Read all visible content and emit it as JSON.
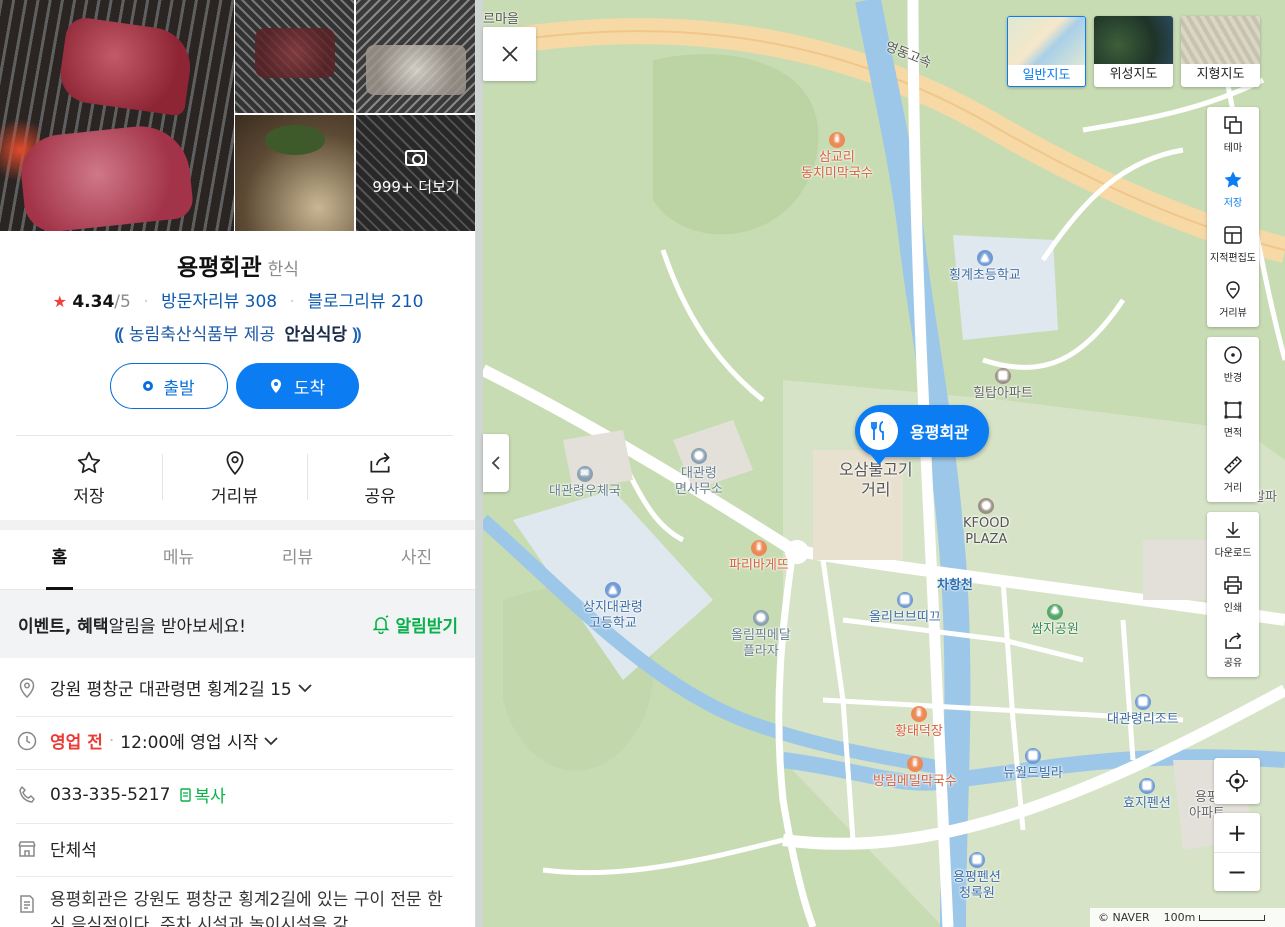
{
  "place": {
    "name": "용평회관",
    "category": "한식",
    "rating_star": "★",
    "rating": "4.34",
    "rating_max": "/5",
    "visitor_reviews": "방문자리뷰 308",
    "blog_reviews": "블로그리뷰 210",
    "cert_text": "농림축산식품부 제공",
    "cert_brand": "안심식당",
    "more_photos": "999+ 더보기"
  },
  "directions": {
    "start_label": "출발",
    "end_label": "도착"
  },
  "actions": [
    {
      "label": "저장",
      "icon": "star-outline-icon"
    },
    {
      "label": "거리뷰",
      "icon": "location-pin-icon"
    },
    {
      "label": "공유",
      "icon": "share-icon"
    }
  ],
  "tabs": [
    "홈",
    "메뉴",
    "리뷰",
    "사진"
  ],
  "notice": {
    "bold": "이벤트, 혜택",
    "rest": " 알림을 받아보세요!",
    "button": "알림받기"
  },
  "info": {
    "address": "강원 평창군 대관령면 횡계2길 15",
    "status": "영업 전",
    "hours": "12:00에 영업 시작",
    "phone": "033-335-5217",
    "copy": "복사",
    "facility": "단체석",
    "description": "용평회관은 강원도 평창군 횡계2길에 있는 구이 전문 한식 음식점이다. 주차 시설과 놀이시설을 갖"
  },
  "map": {
    "map_types": [
      "일반지도",
      "위성지도",
      "지형지도"
    ],
    "tools_a": [
      "테마",
      "저장",
      "지적편집도",
      "거리뷰"
    ],
    "tools_b": [
      "반경",
      "면적",
      "거리"
    ],
    "tools_c": [
      "다운로드",
      "인쇄",
      "공유"
    ],
    "zoom_in": "+",
    "zoom_out": "−",
    "copyright": "© NAVER",
    "scale": "100m",
    "marker_label": "용평회관",
    "pois": {
      "p1": "삼교리\n동치미막국수",
      "p2": "횡계초등학교",
      "p3": "힐탑아파트",
      "p4": "대관령\n면사무소",
      "p5": "대관령우체국",
      "p6": "오삼불고기\n거리",
      "p7": "KFOOD\nPLAZA",
      "p8": "파리바게뜨",
      "p9": "상지대관령\n고등학교",
      "p10": "올림픽메달\n플라자",
      "p11": "올리브브띠끄",
      "p12": "쌈지공원",
      "p13": "황태덕장",
      "p14": "방림메밀막국수",
      "p15": "대관령리조트",
      "p16": "뉴월드빌라",
      "p17": "효지펜션",
      "p18": "용평펜션\n청록원",
      "p19": "차항천",
      "p20": "영동고속",
      "p21": "용평\n아파트",
      "p22": "알파",
      "p23": "르마을"
    }
  }
}
